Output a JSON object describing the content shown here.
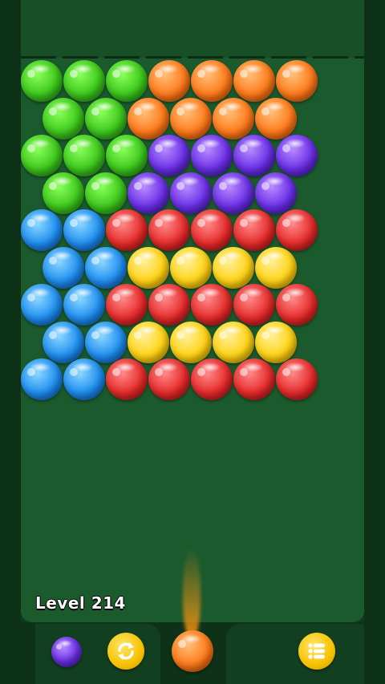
{
  "level_label": "Level 214",
  "colors": {
    "green": "#3dc81c",
    "orange": "#ff7a1a",
    "purple": "#6a2ee6",
    "blue": "#1f8ef0",
    "red": "#e62b2b",
    "yellow": "#ffd314",
    "board": "#1b5a2d"
  },
  "grid": [
    [
      "green",
      "green",
      "green",
      "orange",
      "orange",
      "orange",
      "orange"
    ],
    [
      "green",
      "green",
      "orange",
      "orange",
      "orange",
      "orange"
    ],
    [
      "green",
      "green",
      "green",
      "purple",
      "purple",
      "purple",
      "purple"
    ],
    [
      "green",
      "green",
      "purple",
      "purple",
      "purple",
      "purple"
    ],
    [
      "blue",
      "blue",
      "red",
      "red",
      "red",
      "red",
      "red"
    ],
    [
      "blue",
      "blue",
      "yellow",
      "yellow",
      "yellow",
      "yellow"
    ],
    [
      "blue",
      "blue",
      "red",
      "red",
      "red",
      "red",
      "red"
    ],
    [
      "blue",
      "blue",
      "yellow",
      "yellow",
      "yellow",
      "yellow"
    ],
    [
      "blue",
      "blue",
      "red",
      "red",
      "red",
      "red",
      "red"
    ]
  ],
  "shooter": {
    "color": "orange"
  },
  "next_bubble": {
    "color": "purple"
  },
  "buttons": {
    "swap": {
      "icon": "swap-arrows-icon"
    },
    "menu": {
      "icon": "list-menu-icon"
    }
  }
}
